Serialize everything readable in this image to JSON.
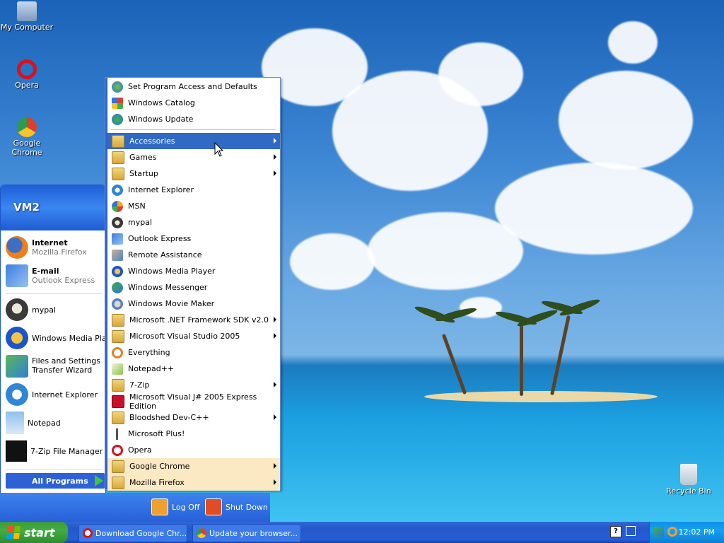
{
  "desktop": {
    "icons": [
      {
        "label": "My Computer"
      },
      {
        "label": "Opera"
      },
      {
        "label": "Google Chrome"
      },
      {
        "label": "Recycle Bin"
      }
    ]
  },
  "start_menu": {
    "user": "VM2",
    "pinned": [
      {
        "title": "Internet",
        "subtitle": "Mozilla Firefox"
      },
      {
        "title": "E-mail",
        "subtitle": "Outlook Express"
      }
    ],
    "recent": [
      {
        "label": "mypal"
      },
      {
        "label": "Windows Media Player"
      },
      {
        "label": "Files and Settings Transfer Wizard"
      },
      {
        "label": "Internet Explorer"
      },
      {
        "label": "Notepad"
      },
      {
        "label": "7-Zip File Manager"
      }
    ],
    "all_programs": "All Programs",
    "log_off": "Log Off",
    "shut_down": "Shut Down"
  },
  "programs_menu": {
    "items": [
      {
        "label": "Set Program Access and Defaults"
      },
      {
        "label": "Windows Catalog"
      },
      {
        "label": "Windows Update"
      },
      {
        "label": "Accessories"
      },
      {
        "label": "Games"
      },
      {
        "label": "Startup"
      },
      {
        "label": "Internet Explorer"
      },
      {
        "label": "MSN"
      },
      {
        "label": "mypal"
      },
      {
        "label": "Outlook Express"
      },
      {
        "label": "Remote Assistance"
      },
      {
        "label": "Windows Media Player"
      },
      {
        "label": "Windows Messenger"
      },
      {
        "label": "Windows Movie Maker"
      },
      {
        "label": "Microsoft .NET Framework SDK v2.0"
      },
      {
        "label": "Microsoft Visual Studio 2005"
      },
      {
        "label": "Everything"
      },
      {
        "label": "Notepad++"
      },
      {
        "label": "7-Zip"
      },
      {
        "label": "Microsoft Visual J# 2005 Express Edition"
      },
      {
        "label": "Bloodshed Dev-C++"
      },
      {
        "label": "Microsoft Plus!"
      },
      {
        "label": "Opera"
      },
      {
        "label": "Google Chrome"
      },
      {
        "label": "Mozilla Firefox"
      }
    ]
  },
  "taskbar": {
    "start_label": "start",
    "buttons": [
      {
        "label": "Download Google Chr..."
      },
      {
        "label": "Update your browser..."
      }
    ],
    "clock": "12:02 PM"
  },
  "colors": {
    "selection": "#316ac5",
    "new_item": "#fbe9c4",
    "taskbar": "#245dd6",
    "start_button": "#42ad42"
  }
}
